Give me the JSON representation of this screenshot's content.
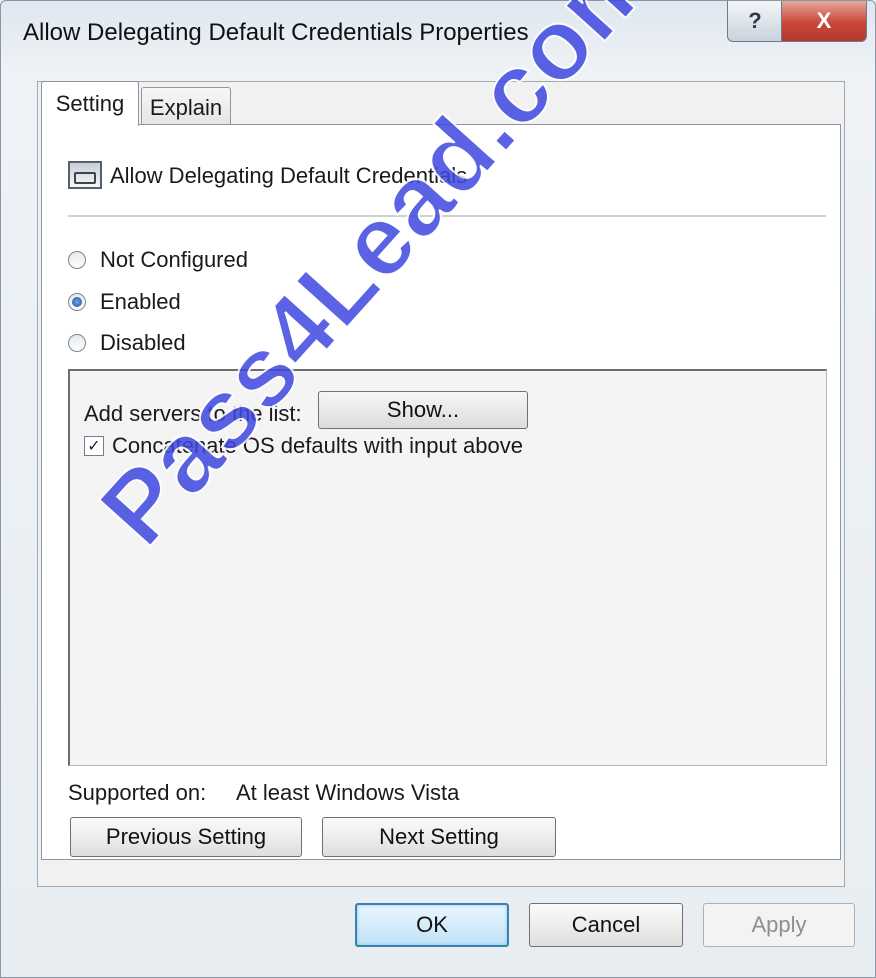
{
  "window": {
    "title": "Allow Delegating Default Credentials Properties",
    "help_glyph": "?",
    "close_glyph": "X"
  },
  "tabs": [
    {
      "label": "Setting",
      "selected": true
    },
    {
      "label": "Explain",
      "selected": false
    }
  ],
  "policy": {
    "icon": "policy-setting-icon",
    "name": "Allow Delegating Default Credentials"
  },
  "state": {
    "options": [
      {
        "label": "Not Configured",
        "selected": false
      },
      {
        "label": "Enabled",
        "selected": true
      },
      {
        "label": "Disabled",
        "selected": false
      }
    ]
  },
  "options_panel": {
    "add_servers_label": "Add servers to the list:",
    "show_button": "Show...",
    "concatenate_label": "Concatenate OS defaults with input above",
    "concatenate_checked": true
  },
  "supported": {
    "label": "Supported on:",
    "value": "At least Windows Vista"
  },
  "nav": {
    "previous": "Previous Setting",
    "next": "Next Setting"
  },
  "footer": {
    "ok": "OK",
    "cancel": "Cancel",
    "apply": "Apply",
    "apply_enabled": false
  },
  "watermark": "Pass4Lead.com",
  "colors": {
    "watermark": "#3f48e0",
    "close_button": "#c8473a",
    "radio_selected": "#1f4f9a"
  }
}
